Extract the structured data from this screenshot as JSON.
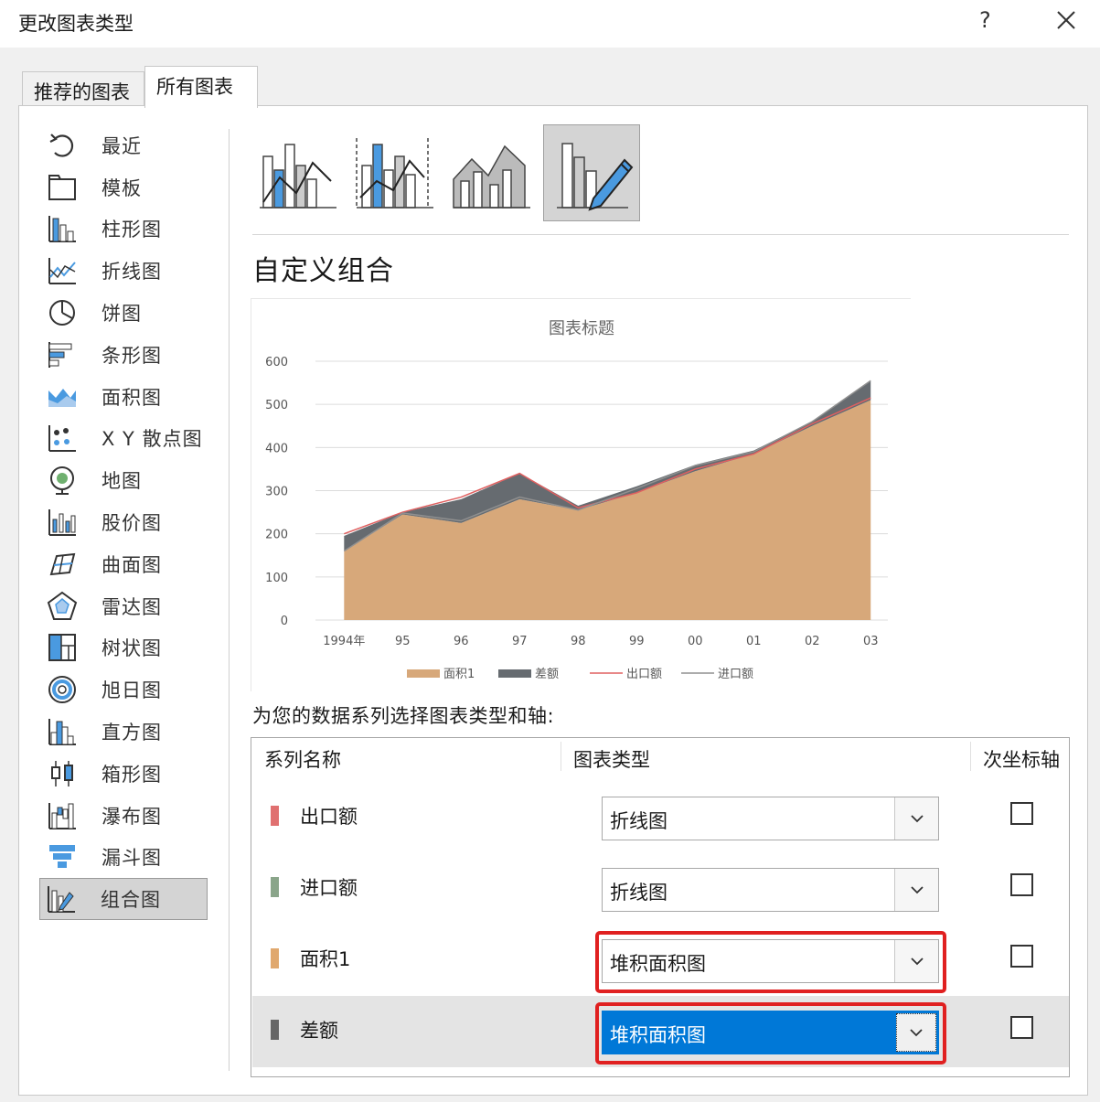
{
  "dialog": {
    "title": "更改图表类型",
    "help": "?",
    "close": "✕"
  },
  "tabs": [
    {
      "label": "推荐的图表",
      "active": false
    },
    {
      "label": "所有图表",
      "active": true
    }
  ],
  "nav": [
    {
      "label": "最近",
      "icon": "recent-icon"
    },
    {
      "label": "模板",
      "icon": "template-icon"
    },
    {
      "label": "柱形图",
      "icon": "column-chart-icon"
    },
    {
      "label": "折线图",
      "icon": "line-chart-icon"
    },
    {
      "label": "饼图",
      "icon": "pie-chart-icon"
    },
    {
      "label": "条形图",
      "icon": "bar-chart-icon"
    },
    {
      "label": "面积图",
      "icon": "area-chart-icon"
    },
    {
      "label": "X Y 散点图",
      "icon": "scatter-chart-icon"
    },
    {
      "label": "地图",
      "icon": "map-chart-icon"
    },
    {
      "label": "股价图",
      "icon": "stock-chart-icon"
    },
    {
      "label": "曲面图",
      "icon": "surface-chart-icon"
    },
    {
      "label": "雷达图",
      "icon": "radar-chart-icon"
    },
    {
      "label": "树状图",
      "icon": "treemap-chart-icon"
    },
    {
      "label": "旭日图",
      "icon": "sunburst-chart-icon"
    },
    {
      "label": "直方图",
      "icon": "histogram-chart-icon"
    },
    {
      "label": "箱形图",
      "icon": "box-chart-icon"
    },
    {
      "label": "瀑布图",
      "icon": "waterfall-chart-icon"
    },
    {
      "label": "漏斗图",
      "icon": "funnel-chart-icon"
    },
    {
      "label": "组合图",
      "icon": "combo-chart-icon",
      "active": true
    }
  ],
  "subtypes": {
    "selected_index": 3
  },
  "section_title": "自定义组合",
  "chart_data": {
    "type": "area",
    "title": "图表标题",
    "categories": [
      "1994年",
      "95",
      "96",
      "97",
      "98",
      "99",
      "00",
      "01",
      "02",
      "03"
    ],
    "ylim": [
      0,
      600
    ],
    "yticks": [
      "0",
      "100",
      "200",
      "300",
      "400",
      "500",
      "600"
    ],
    "series": [
      {
        "name": "面积1",
        "kind": "stacked-area",
        "color": "#d7a87a",
        "values": [
          160,
          245,
          225,
          280,
          255,
          295,
          345,
          385,
          450,
          510
        ]
      },
      {
        "name": "差额",
        "kind": "stacked-area",
        "color": "#666b70",
        "values": [
          35,
          5,
          55,
          60,
          10,
          15,
          15,
          8,
          10,
          45
        ]
      },
      {
        "name": "出口额",
        "kind": "line",
        "color": "#e06060",
        "values": [
          200,
          250,
          285,
          340,
          260,
          295,
          350,
          385,
          455,
          515
        ]
      },
      {
        "name": "进口额",
        "kind": "line",
        "color": "#909090",
        "values": [
          160,
          248,
          230,
          285,
          255,
          305,
          358,
          390,
          460,
          555
        ]
      }
    ],
    "grid": true,
    "legend": "bottom"
  },
  "instruction": "为您的数据系列选择图表类型和轴:",
  "grid": {
    "headers": {
      "name": "系列名称",
      "type": "图表类型",
      "secondary": "次坐标轴"
    },
    "rows": [
      {
        "name": "出口额",
        "type": "折线图",
        "color": "#e07070",
        "secondary": false,
        "highlight": false,
        "selected": false,
        "boxed": false
      },
      {
        "name": "进口额",
        "type": "折线图",
        "color": "#8aa58a",
        "secondary": false,
        "highlight": false,
        "selected": false,
        "boxed": false
      },
      {
        "name": "面积1",
        "type": "堆积面积图",
        "color": "#e0a86e",
        "secondary": false,
        "highlight": false,
        "selected": false,
        "boxed": true
      },
      {
        "name": "差额",
        "type": "堆积面积图",
        "color": "#666666",
        "secondary": false,
        "highlight": true,
        "selected": true,
        "boxed": true
      }
    ]
  }
}
